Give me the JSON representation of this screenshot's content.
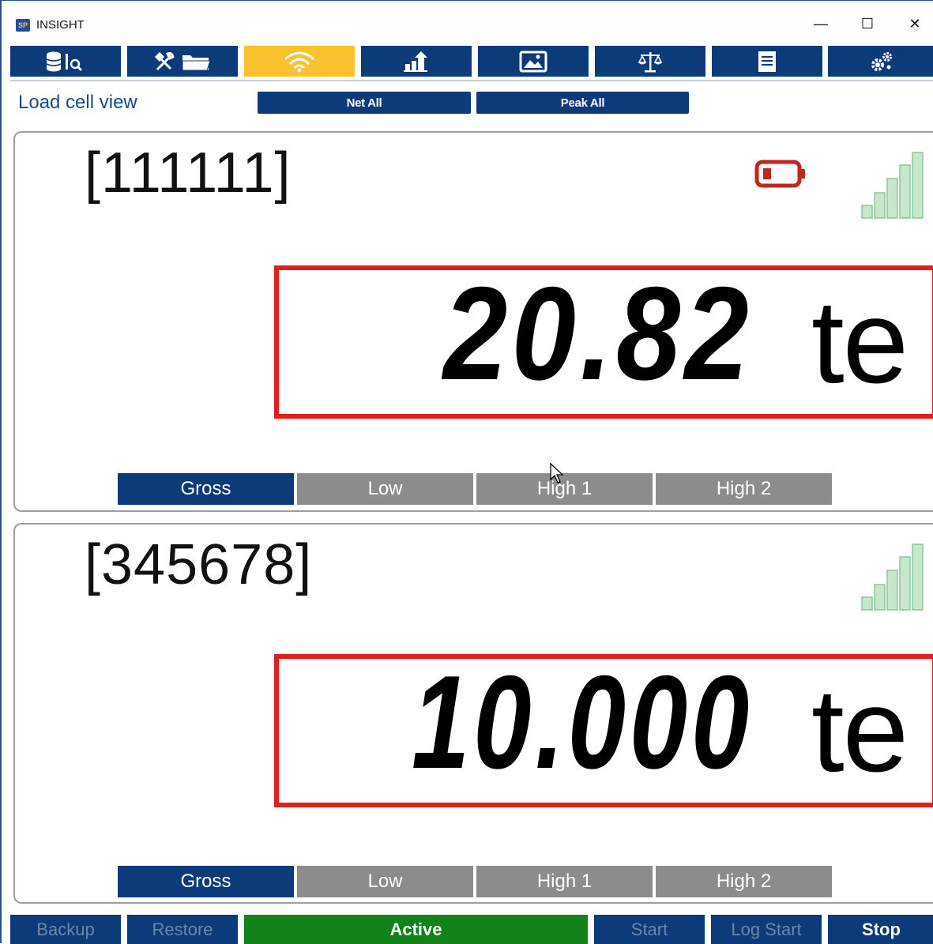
{
  "window": {
    "title": "INSIGHT",
    "logo_text": "SP",
    "minimize_glyph": "—",
    "maximize_glyph": "☐",
    "close_glyph": "✕"
  },
  "toolbar": {
    "buttons": [
      {
        "icon": "database-search-icon",
        "active": false
      },
      {
        "icon": "tools-folder-icon",
        "active": false
      },
      {
        "icon": "wifi-icon",
        "active": true
      },
      {
        "icon": "export-chart-icon",
        "active": false
      },
      {
        "icon": "image-icon",
        "active": false
      },
      {
        "icon": "scale-icon",
        "active": false
      },
      {
        "icon": "document-icon",
        "active": false
      },
      {
        "icon": "settings-gears-icon",
        "active": false
      }
    ],
    "active_color": "#f9c22e",
    "button_color": "#0d3b7a"
  },
  "header": {
    "title": "Load cell view",
    "net_all_label": "Net All",
    "peak_all_label": "Peak All"
  },
  "cells": [
    {
      "id": "[111111]",
      "value": "20.82",
      "unit": "te",
      "battery": {
        "shown": true,
        "level": "low",
        "color": "#c0281f"
      },
      "signal": {
        "bars": 5,
        "color": "#a8d5b0"
      },
      "modes": [
        "Gross",
        "Low",
        "High 1",
        "High 2"
      ],
      "selected_mode": "Gross"
    },
    {
      "id": "[345678]",
      "value": "10.000",
      "unit": "te",
      "battery": {
        "shown": false
      },
      "signal": {
        "bars": 5,
        "color": "#a8d5b0"
      },
      "modes": [
        "Gross",
        "Low",
        "High 1",
        "High 2"
      ],
      "selected_mode": "Gross"
    }
  ],
  "footer": {
    "backup_label": "Backup",
    "restore_label": "Restore",
    "status_label": "Active",
    "start_label": "Start",
    "log_start_label": "Log Start",
    "stop_label": "Stop",
    "status_color": "#13821a"
  }
}
